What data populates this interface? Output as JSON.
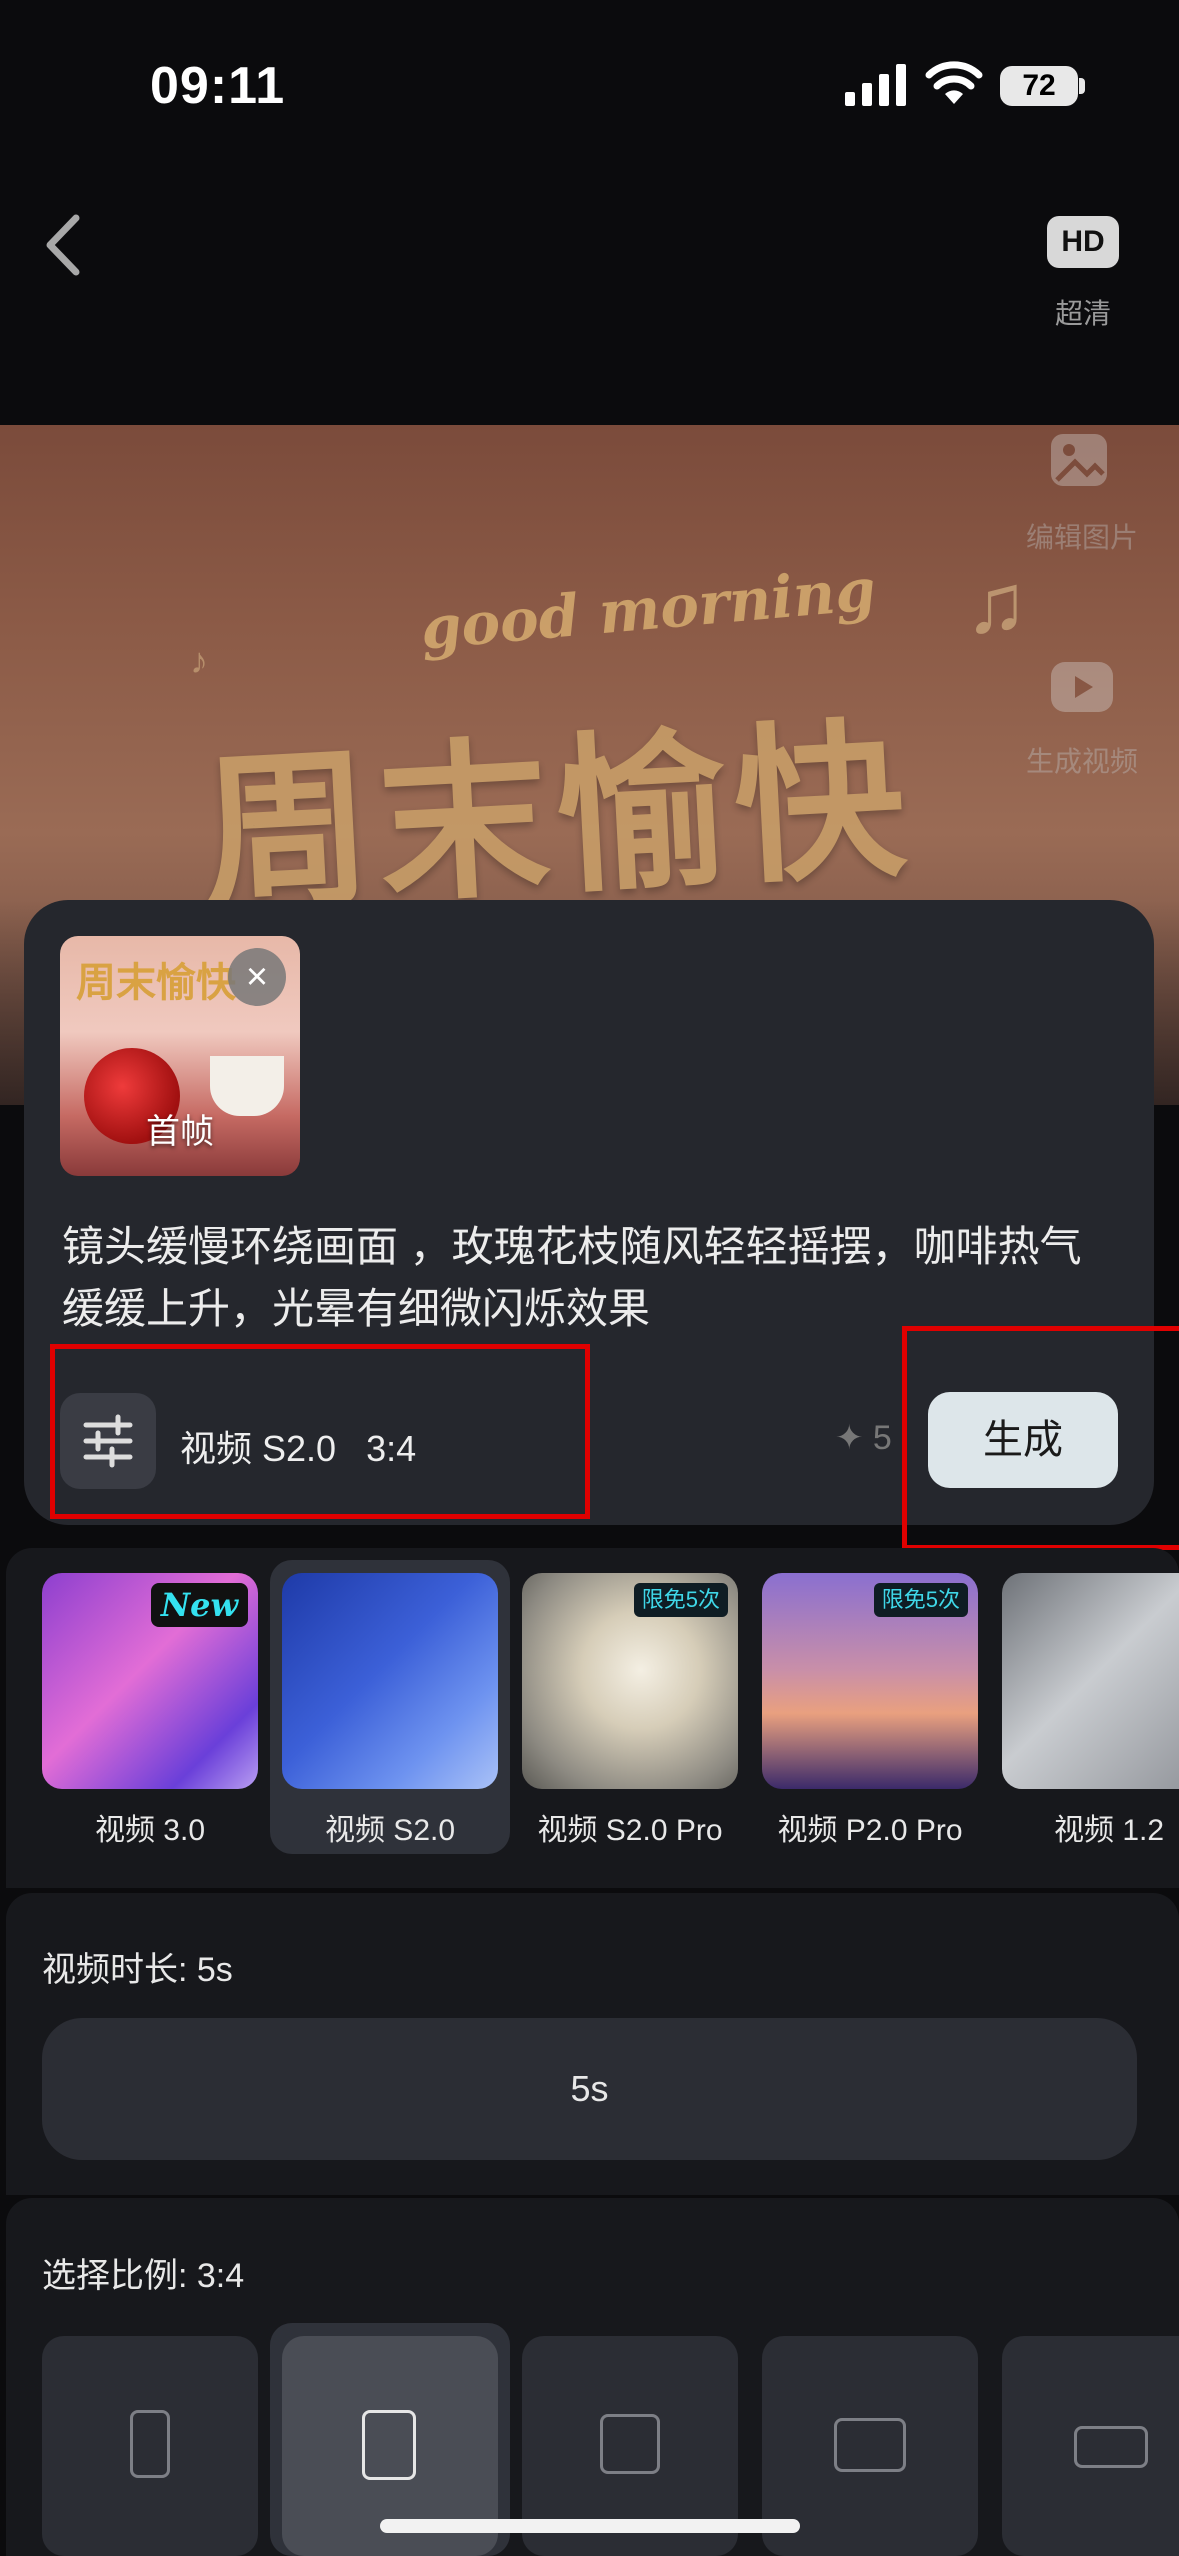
{
  "status_bar": {
    "time": "09:11",
    "battery": "72"
  },
  "nav": {
    "back_icon": "chevron-left-icon",
    "hd_badge": "HD",
    "hd_label": "超清"
  },
  "hero": {
    "subtitle": "good morning",
    "title": "周末愉快",
    "side_actions": [
      {
        "icon": "edit-image-icon",
        "label": "编辑图片"
      },
      {
        "icon": "play-video-icon",
        "label": "生成视频"
      }
    ]
  },
  "prompt_card": {
    "thumbnail_title": "周末愉快",
    "thumbnail_label": "首帧",
    "prompt_text": "镜头缓慢环绕画面 ，玫瑰花枝随风轻轻摇摆，咖啡热气缓缓上升，光晕有细微闪烁效果",
    "settings_label": "视频 S2.0   3:4",
    "credit": "✦ 5",
    "generate_label": "生成"
  },
  "models": [
    {
      "name": "视频 3.0",
      "badge": "New",
      "selected": false
    },
    {
      "name": "视频 S2.0",
      "badge": "",
      "selected": true
    },
    {
      "name": "视频 S2.0 Pro",
      "badge": "限免5次",
      "selected": false
    },
    {
      "name": "视频 P2.0 Pro",
      "badge": "限免5次",
      "selected": false
    },
    {
      "name": "视频 1.2",
      "badge": "",
      "selected": false
    }
  ],
  "duration": {
    "title": "视频时长: 5s",
    "option": "5s"
  },
  "ratio": {
    "title": "选择比例: 3:4",
    "options": [
      "9:16",
      "3:4",
      "1:1",
      "4:3",
      "16:9"
    ],
    "selected": "3:4"
  },
  "colors": {
    "accent_cyan": "#34e2f0",
    "highlight_red": "#e00000",
    "card_bg": "#25272d"
  }
}
